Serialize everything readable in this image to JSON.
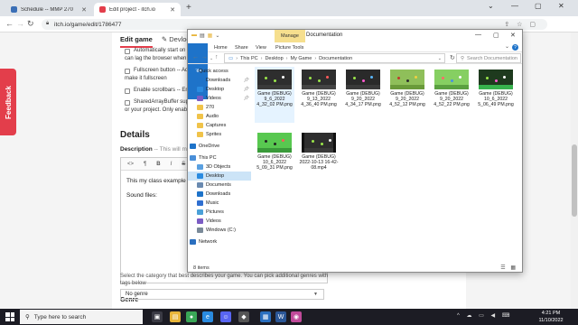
{
  "browser": {
    "tabs": [
      {
        "title": "Schedule -- MMP 270",
        "favicon_color": "#3b6fb6",
        "active": false
      },
      {
        "title": "Edit project - itch.io",
        "favicon_color": "#e33e4b",
        "active": true
      }
    ],
    "url": "itch.io/game/edit/1786477"
  },
  "page": {
    "feedback_label": "Feedback",
    "tabs": [
      "Edit game",
      "Devlog"
    ],
    "checkboxes": [
      {
        "label": "Automatically start on p",
        "sub": "can lag the browser when lo"
      },
      {
        "label": "Fullscreen button -- Add",
        "sub": "make it fullscreen"
      },
      {
        "label": "Enable scrollbars -- Enab",
        "sub": ""
      },
      {
        "label": "SharedArrayBuffer sup",
        "sub": "or your project. Only enable"
      }
    ],
    "details_heading": "Details",
    "description_label": "Description",
    "description_hint": "-- This will make",
    "editor_toolbar": [
      "<>",
      "¶",
      "B",
      "I",
      "S"
    ],
    "editor_lines": [
      "This my class example proje",
      "Sound files:"
    ],
    "genre_heading": "Genre",
    "genre_desc": "Select the category that best describes your game. You can pick additional genres with tags below",
    "genre_value": "No genre"
  },
  "explorer": {
    "title": "Documentation",
    "manage_label": "Manage",
    "ribbon_tabs": [
      "File",
      "Home",
      "Share",
      "View",
      "Picture Tools"
    ],
    "path": [
      "This PC",
      "Desktop",
      "My Game",
      "Documentation"
    ],
    "search_placeholder": "Search Documentation",
    "nav_items": [
      {
        "label": "Quick access",
        "icon_color": "#1e73c9",
        "pin": false,
        "selected": false
      },
      {
        "label": "Downloads",
        "icon_color": "#1e73c9",
        "pin": true,
        "selected": false
      },
      {
        "label": "Desktop",
        "icon_color": "#2a8be0",
        "pin": true,
        "selected": false
      },
      {
        "label": "Videos",
        "icon_color": "#7b5cc4",
        "pin": true,
        "selected": false
      },
      {
        "label": "270",
        "icon_color": "#f0c34a",
        "pin": false,
        "selected": false
      },
      {
        "label": "Audio",
        "icon_color": "#f0c34a",
        "pin": false,
        "selected": false
      },
      {
        "label": "Captures",
        "icon_color": "#f0c34a",
        "pin": false,
        "selected": false
      },
      {
        "label": "Sprites",
        "icon_color": "#f0c34a",
        "pin": false,
        "selected": false
      },
      {
        "label": "OneDrive",
        "icon_color": "#1e73c9",
        "pin": false,
        "selected": false
      },
      {
        "label": "This PC",
        "icon_color": "#4a8fd8",
        "pin": false,
        "selected": false
      },
      {
        "label": "3D Objects",
        "icon_color": "#5aa0e0",
        "pin": false,
        "selected": false
      },
      {
        "label": "Desktop",
        "icon_color": "#2a8be0",
        "pin": false,
        "selected": true
      },
      {
        "label": "Documents",
        "icon_color": "#6a8ab0",
        "pin": false,
        "selected": false
      },
      {
        "label": "Downloads",
        "icon_color": "#1e73c9",
        "pin": false,
        "selected": false
      },
      {
        "label": "Music",
        "icon_color": "#2f6fd0",
        "pin": false,
        "selected": false
      },
      {
        "label": "Pictures",
        "icon_color": "#4aa0d8",
        "pin": false,
        "selected": false
      },
      {
        "label": "Videos",
        "icon_color": "#7b5cc4",
        "pin": false,
        "selected": false
      },
      {
        "label": "Windows (C:)",
        "icon_color": "#7a8a99",
        "pin": false,
        "selected": false
      },
      {
        "label": "Network",
        "icon_color": "#2a6fbf",
        "pin": false,
        "selected": false
      }
    ],
    "files": [
      {
        "name": "Game (DEBUG) 9_6_2022 4_32_02 PM.png",
        "bg": "#2e2e2e",
        "ground": "#3a3a3a",
        "dots": [
          "#9be64b",
          "#9be64b",
          "#ffffff"
        ],
        "selected": true,
        "video": false
      },
      {
        "name": "Game (DEBUG) 9_13_2022 4_36_40 PM.png",
        "bg": "#2e2e2e",
        "ground": "#444444",
        "dots": [
          "#9be64b",
          "#9be64b",
          "#ff5a5a"
        ],
        "selected": false,
        "video": false
      },
      {
        "name": "Game (DEBUG) 9_20_2022 4_34_17 PM.png",
        "bg": "#2a2a2a",
        "ground": "#3a3a3a",
        "dots": [
          "#9be64b",
          "#ff5ad0",
          "#5ab8ff"
        ],
        "selected": false,
        "video": false
      },
      {
        "name": "Game (DEBUG) 9_20_2022 4_52_12 PM.png",
        "bg": "#8fbf5a",
        "ground": "#6a9a3a",
        "dots": [
          "#c0392b",
          "#2d2d2d",
          "#f0d040"
        ],
        "selected": false,
        "video": false
      },
      {
        "name": "Game (DEBUG) 9_20_2022 4_52_22 PM.png",
        "bg": "#86cf62",
        "ground": "#5aa040",
        "dots": [
          "#ff6a6a",
          "#4a90e2",
          "#ffffff"
        ],
        "selected": false,
        "video": false
      },
      {
        "name": "Game (DEBUG) 10_6_2022 5_06_49 PM.png",
        "bg": "#1e3a1e",
        "ground": "#37b24d",
        "dots": [
          "#9be64b",
          "#ff5ad0",
          "#ffffff"
        ],
        "selected": false,
        "video": false
      },
      {
        "name": "Game (DEBUG) 10_6_2022 5_09_31 PM.png",
        "bg": "#58c850",
        "ground": "#3a9a3a",
        "dots": [
          "#222222",
          "#222222",
          "#ff5a5a"
        ],
        "selected": false,
        "video": false
      },
      {
        "name": "Game (DEBUG) 2022-10-13 16-42-08.mp4",
        "bg": "#2e2e2e",
        "ground": "#3a3a3a",
        "dots": [
          "#9be64b",
          "#9be64b",
          "#ffffff"
        ],
        "selected": false,
        "video": true
      }
    ],
    "status": "8 items"
  },
  "taskbar": {
    "search_placeholder": "Type here to search",
    "apps": [
      {
        "name": "task-view",
        "color": "#3a3a44",
        "glyph": "▣"
      },
      {
        "name": "file-explorer",
        "color": "#e8b53a",
        "glyph": "▤"
      },
      {
        "name": "chrome",
        "color": "#3aa757",
        "glyph": "●"
      },
      {
        "name": "edge",
        "color": "#2a8be0",
        "glyph": "e"
      },
      {
        "name": "discord",
        "color": "#5865f2",
        "glyph": "☺"
      },
      {
        "name": "unity",
        "color": "#555555",
        "glyph": "◆"
      },
      {
        "name": "store",
        "color": "#2a6fbf",
        "glyph": "▦"
      },
      {
        "name": "word",
        "color": "#2b5797",
        "glyph": "W"
      },
      {
        "name": "photos",
        "color": "#c04a9a",
        "glyph": "◉"
      }
    ],
    "time": "4:21 PM",
    "date": "11/10/2022"
  }
}
